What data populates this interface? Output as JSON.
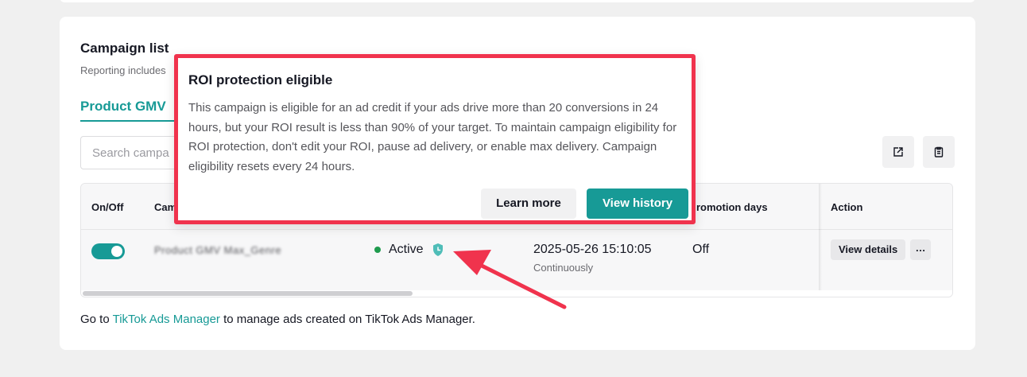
{
  "campaign_section": {
    "title": "Campaign list",
    "subtitle": "Reporting includes",
    "tab": "Product GMV",
    "search_placeholder": "Search campa"
  },
  "table": {
    "columns": {
      "onoff": "On/Off",
      "campaign": "Cam",
      "promotion": "romotion days",
      "action": "Action"
    },
    "row": {
      "toggle_on": true,
      "campaign_name": "Product GMV Max_Genre",
      "status": "Active",
      "start": "2025-05-26 15:10:05",
      "schedule": "Continuously",
      "promotion_days": "Off",
      "view_details": "View details",
      "more": "…"
    }
  },
  "footer": {
    "before": "Go to ",
    "link": "TikTok Ads Manager",
    "after": " to manage ads created on TikTok Ads Manager."
  },
  "popover": {
    "title": "ROI protection eligible",
    "body": "This campaign is eligible for an ad credit if your ads drive more than 20 conversions in 24 hours, but your ROI result is less than 90% of your target. To maintain campaign eligibility for ROI protection, don't edit your ROI, pause ad delivery, or enable max delivery. Campaign eligibility resets every 24 hours.",
    "learn_more": "Learn more",
    "view_history": "View history"
  },
  "colors": {
    "accent": "#179a96",
    "highlight": "#f0334d",
    "active_dot": "#1f9b4e"
  }
}
